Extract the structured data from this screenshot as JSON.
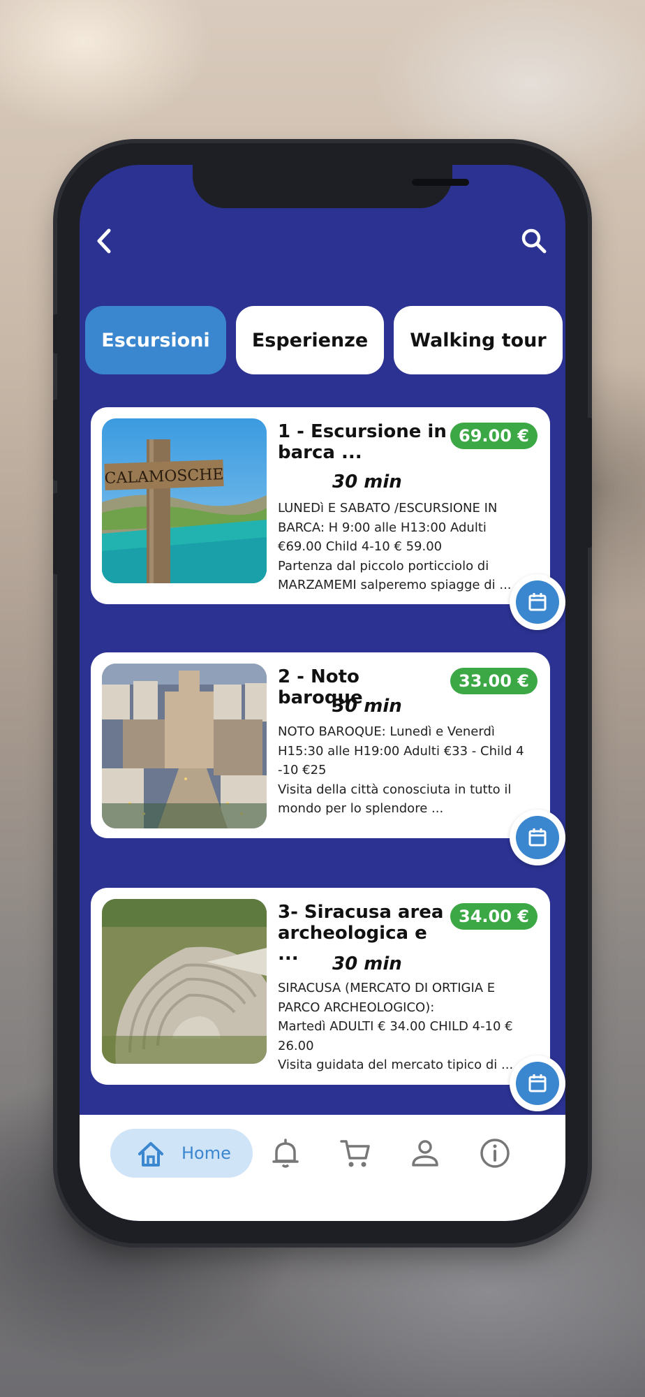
{
  "tabs": [
    {
      "label": "Escursioni",
      "active": true
    },
    {
      "label": "Esperienze",
      "active": false
    },
    {
      "label": "Walking tour",
      "active": false
    }
  ],
  "cards": [
    {
      "title": "1 - Escursione in barca ...",
      "price": "69.00 €",
      "duration": "30 min",
      "image_alt": "CALAMOSCHE",
      "description": "LUNEDì E SABATO /ESCURSIONE IN BARCA: H 9:00 alle H13:00 Adulti €69.00 Child 4-10 € 59.00\nPartenza dal piccolo porticciolo di MARZAMEMI salperemo spiagge di ..."
    },
    {
      "title": "2 - Noto baroque",
      "price": "33.00 €",
      "duration": "30 min",
      "description": "NOTO BAROQUE: Lunedì e Venerdì H15:30 alle H19:00 Adulti €33 - Child 4 -10 €25\nVisita della città conosciuta in tutto il mondo per lo splendore ..."
    },
    {
      "title": "3- Siracusa area archeologica e ...",
      "price": "34.00 €",
      "duration": "30 min",
      "description": "SIRACUSA (MERCATO DI ORTIGIA E PARCO ARCHEOLOGICO):\nMartedì ADULTI € 34.00 CHILD 4-10 € 26.00\nVisita guidata del mercato tipico di ..."
    }
  ],
  "bottom_nav": {
    "home_label": "Home",
    "items": [
      "home-icon",
      "bell-icon",
      "cart-icon",
      "user-icon",
      "info-icon"
    ]
  },
  "colors": {
    "screen_bg": "#2b3291",
    "accent": "#3a86cf",
    "price_badge": "#3ca845"
  }
}
